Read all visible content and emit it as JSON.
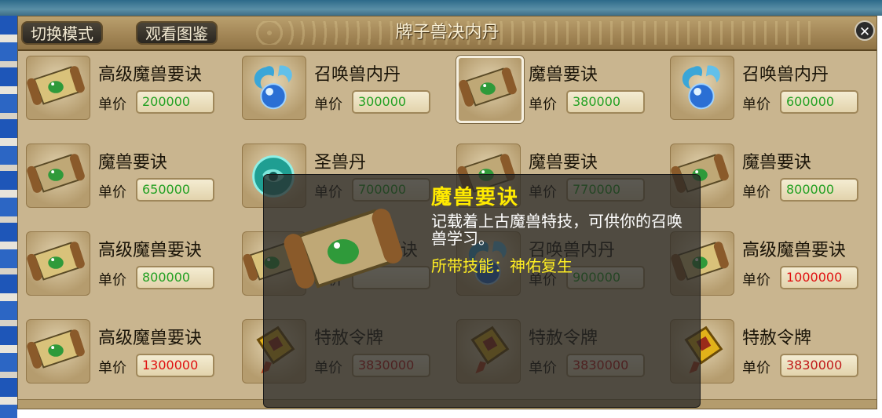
{
  "window": {
    "title": "牌子兽决内丹"
  },
  "tabs": [
    {
      "label": "切换模式"
    },
    {
      "label": "观看图鉴"
    }
  ],
  "close_label": "✕",
  "price_label": "单价",
  "items": [
    {
      "name": "高级魔兽要诀",
      "price": "200000",
      "price_color": "#22a022",
      "icon": "advanced-skill-scroll-icon"
    },
    {
      "name": "召唤兽内丹",
      "price": "300000",
      "price_color": "#22a022",
      "icon": "beast-inner-pill-icon"
    },
    {
      "name": "魔兽要诀",
      "price": "380000",
      "price_color": "#22a022",
      "icon": "skill-scroll-icon",
      "selected": true
    },
    {
      "name": "召唤兽内丹",
      "price": "600000",
      "price_color": "#22a022",
      "icon": "beast-inner-pill-icon"
    },
    {
      "name": "魔兽要诀",
      "price": "650000",
      "price_color": "#22a022",
      "icon": "skill-scroll-icon"
    },
    {
      "name": "圣兽丹",
      "price": "700000",
      "price_color": "#22a022",
      "icon": "holy-beast-pill-icon"
    },
    {
      "name": "魔兽要诀",
      "price": "770000",
      "price_color": "#22a022",
      "icon": "skill-scroll-icon"
    },
    {
      "name": "魔兽要诀",
      "price": "800000",
      "price_color": "#22a022",
      "icon": "skill-scroll-icon"
    },
    {
      "name": "高级魔兽要诀",
      "price": "800000",
      "price_color": "#22a022",
      "icon": "advanced-skill-scroll-icon"
    },
    {
      "name": "高级魔兽要诀",
      "price": "",
      "price_color": "#22a022",
      "icon": "advanced-skill-scroll-icon"
    },
    {
      "name": "召唤兽内丹",
      "price": "900000",
      "price_color": "#22a022",
      "icon": "beast-inner-pill-icon"
    },
    {
      "name": "高级魔兽要诀",
      "price": "1000000",
      "price_color": "#e01010",
      "icon": "advanced-skill-scroll-icon"
    },
    {
      "name": "高级魔兽要诀",
      "price": "1300000",
      "price_color": "#e01010",
      "icon": "advanced-skill-scroll-icon"
    },
    {
      "name": "特赦令牌",
      "price": "3830000",
      "price_color": "#c01818",
      "icon": "pardon-token-icon"
    },
    {
      "name": "特赦令牌",
      "price": "3830000",
      "price_color": "#c01818",
      "icon": "pardon-token-icon"
    },
    {
      "name": "特赦令牌",
      "price": "3830000",
      "price_color": "#c01818",
      "icon": "pardon-token-icon"
    }
  ],
  "tooltip": {
    "title": "魔兽要诀",
    "description": "记载着上古魔兽特技，可供你的召唤兽学习。",
    "skill": "所带技能：神佑复生",
    "icon": "skill-scroll-icon"
  },
  "colors": {
    "panel_bg": "#c9b58f",
    "title_text": "#fbf2d8",
    "tooltip_title": "#ffea00"
  }
}
